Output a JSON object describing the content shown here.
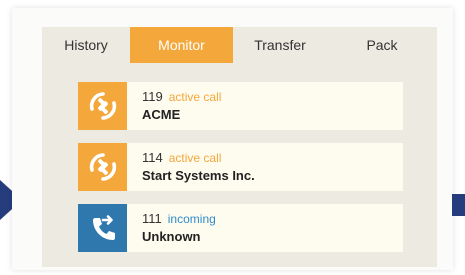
{
  "tabs": [
    {
      "label": "History",
      "active": false
    },
    {
      "label": "Monitor",
      "active": true
    },
    {
      "label": "Transfer",
      "active": false
    },
    {
      "label": "Pack",
      "active": false
    }
  ],
  "calls": [
    {
      "number": "119",
      "status": "active call",
      "name": "ACME",
      "icon": "active-call-icon",
      "color": "#f4a73b",
      "status_color": "#f4a73b"
    },
    {
      "number": "114",
      "status": "active call",
      "name": "Start Systems Inc.",
      "icon": "active-call-icon",
      "color": "#f4a73b",
      "status_color": "#f4a73b"
    },
    {
      "number": "111",
      "status": "incoming",
      "name": "Unknown",
      "icon": "incoming-call-icon",
      "color": "#2f78ad",
      "status_color": "#2f8ccb"
    }
  ],
  "colors": {
    "accent": "#f4a73b",
    "incoming": "#2f78ad",
    "nav_arrow": "#263d7d"
  }
}
